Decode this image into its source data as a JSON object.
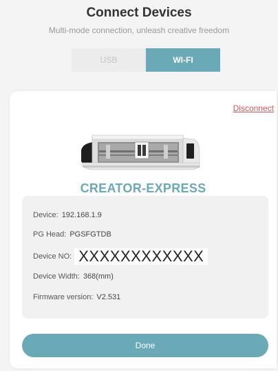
{
  "header": {
    "title": "Connect Devices",
    "subtitle": "Multi-mode connection, unleash creative freedom"
  },
  "tabs": [
    {
      "label": "USB",
      "selected": false
    },
    {
      "label": "WI-FI",
      "selected": true
    }
  ],
  "card": {
    "disconnect_label": "Disconnect",
    "device_name": "CREATOR-EXPRESS",
    "info": {
      "device": {
        "label": "Device:",
        "value": "192.168.1.9"
      },
      "pg_head": {
        "label": "PG Head:",
        "value": "PGSFGTDB"
      },
      "device_no": {
        "label": "Device NO:",
        "value": "XXXXXXXXXXXX"
      },
      "device_width": {
        "label": "Device Width:",
        "value": "368(mm)"
      },
      "firmware": {
        "label": "Firmware version:",
        "value": "V2.531"
      }
    },
    "done_label": "Done"
  },
  "colors": {
    "accent": "#6aaab7",
    "danger": "#e05454",
    "background": "#f4f4f4"
  }
}
